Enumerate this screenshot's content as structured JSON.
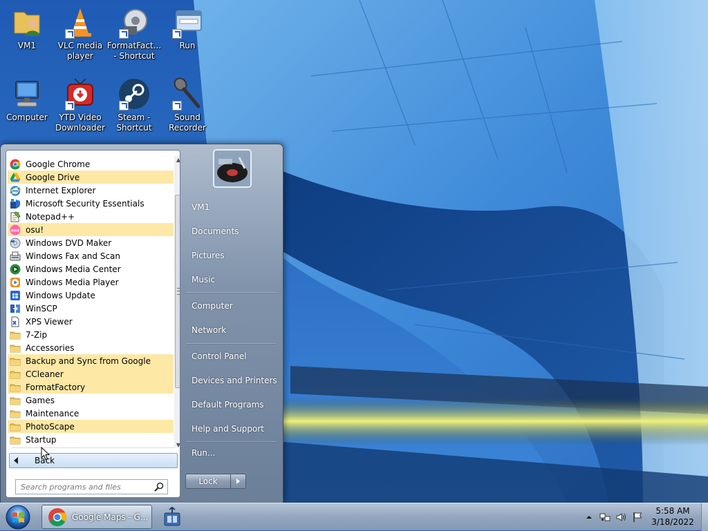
{
  "desktop": {
    "icons": [
      {
        "label": "VM1",
        "icon": "user-folder-icon"
      },
      {
        "label": "VLC media\nplayer",
        "icon": "vlc-cone-icon"
      },
      {
        "label": "FormatFact...\n- Shortcut",
        "icon": "formatfactory-icon"
      },
      {
        "label": "Run",
        "icon": "run-icon"
      },
      {
        "label": "Computer",
        "icon": "computer-icon"
      },
      {
        "label": "YTD Video\nDownloader",
        "icon": "ytd-downloader-icon"
      },
      {
        "label": "Steam -\nShortcut",
        "icon": "steam-icon"
      },
      {
        "label": "Sound\nRecorder",
        "icon": "microphone-icon"
      }
    ]
  },
  "start_menu": {
    "programs": [
      {
        "label": "Google Chrome",
        "icon": "chrome-icon",
        "highlight": false
      },
      {
        "label": "Google Drive",
        "icon": "google-drive-icon",
        "highlight": true
      },
      {
        "label": "Internet Explorer",
        "icon": "internet-explorer-icon",
        "highlight": false
      },
      {
        "label": "Microsoft Security Essentials",
        "icon": "security-shield-icon",
        "highlight": false
      },
      {
        "label": "Notepad++",
        "icon": "notepad-icon",
        "highlight": false
      },
      {
        "label": "osu!",
        "icon": "osu-icon",
        "highlight": true
      },
      {
        "label": "Windows DVD Maker",
        "icon": "dvd-maker-icon",
        "highlight": false
      },
      {
        "label": "Windows Fax and Scan",
        "icon": "fax-scan-icon",
        "highlight": false
      },
      {
        "label": "Windows Media Center",
        "icon": "media-center-icon",
        "highlight": false
      },
      {
        "label": "Windows Media Player",
        "icon": "media-player-icon",
        "highlight": false
      },
      {
        "label": "Windows Update",
        "icon": "windows-update-icon",
        "highlight": false
      },
      {
        "label": "WinSCP",
        "icon": "winscp-icon",
        "highlight": false
      },
      {
        "label": "XPS Viewer",
        "icon": "xps-viewer-icon",
        "highlight": false
      },
      {
        "label": "7-Zip",
        "icon": "folder-icon",
        "highlight": false
      },
      {
        "label": "Accessories",
        "icon": "folder-icon",
        "highlight": false
      },
      {
        "label": "Backup and Sync from Google",
        "icon": "folder-icon",
        "highlight": true
      },
      {
        "label": "CCleaner",
        "icon": "folder-icon",
        "highlight": true
      },
      {
        "label": "FormatFactory",
        "icon": "folder-icon",
        "highlight": true
      },
      {
        "label": "Games",
        "icon": "folder-icon",
        "highlight": false
      },
      {
        "label": "Maintenance",
        "icon": "folder-icon",
        "highlight": false
      },
      {
        "label": "PhotoScape",
        "icon": "folder-icon",
        "highlight": true
      },
      {
        "label": "Startup",
        "icon": "folder-icon",
        "highlight": false
      }
    ],
    "back_label": "Back",
    "search_placeholder": "Search programs and files",
    "right_links": [
      {
        "label": "VM1"
      },
      {
        "label": "Documents"
      },
      {
        "label": "Pictures"
      },
      {
        "label": "Music"
      },
      {
        "label": "Computer"
      },
      {
        "label": "Network"
      },
      {
        "label": "Control Panel"
      },
      {
        "label": "Devices and Printers"
      },
      {
        "label": "Default Programs"
      },
      {
        "label": "Help and Support"
      },
      {
        "label": "Run..."
      }
    ],
    "lock_label": "Lock"
  },
  "taskbar": {
    "active_task": {
      "label": "Google Maps - G...",
      "icon": "chrome-icon"
    },
    "pinned_icon": "network-app-icon",
    "tray_icons": [
      "show-hidden-icons-arrow-icon",
      "network-icon",
      "volume-icon",
      "action-center-flag-icon"
    ],
    "clock_time": "5:58 AM",
    "clock_date": "3/18/2022"
  },
  "colors": {
    "highlight_new_program": "#fde8a6",
    "wallpaper_blue": "#2a63b8"
  }
}
